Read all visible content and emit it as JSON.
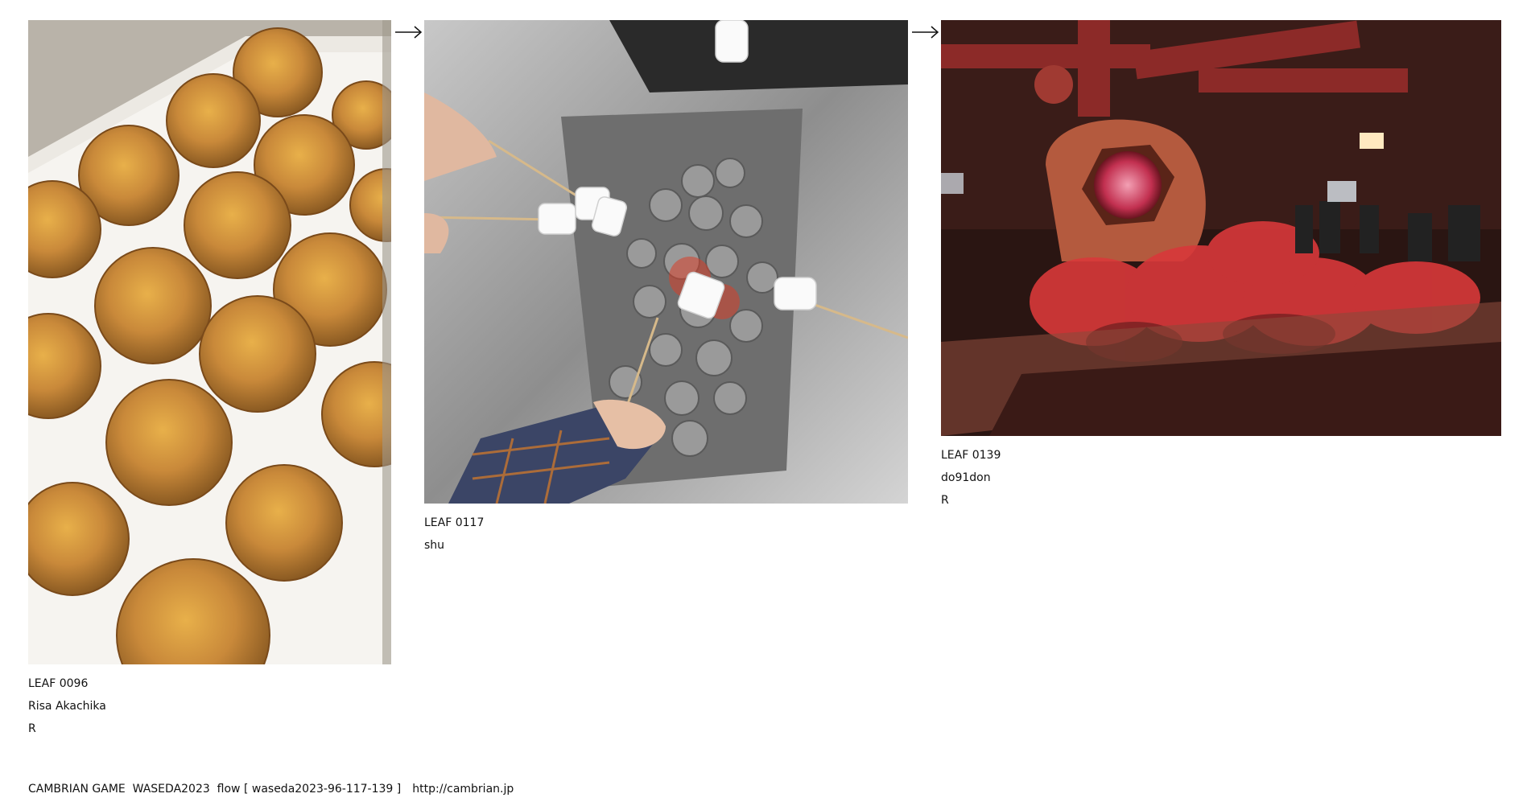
{
  "leaves": [
    {
      "number": "LEAF 0096",
      "author": "Risa Akachika",
      "mark": "R"
    },
    {
      "number": "LEAF 0117",
      "author": "shu",
      "mark": ""
    },
    {
      "number": "LEAF 0139",
      "author": "do91don",
      "mark": "R"
    }
  ],
  "footer": {
    "title": "CAMBRIAN GAME  WASEDA2023  flow [ waseda2023-96-117-139 ]",
    "url": "http://cambrian.jp"
  }
}
